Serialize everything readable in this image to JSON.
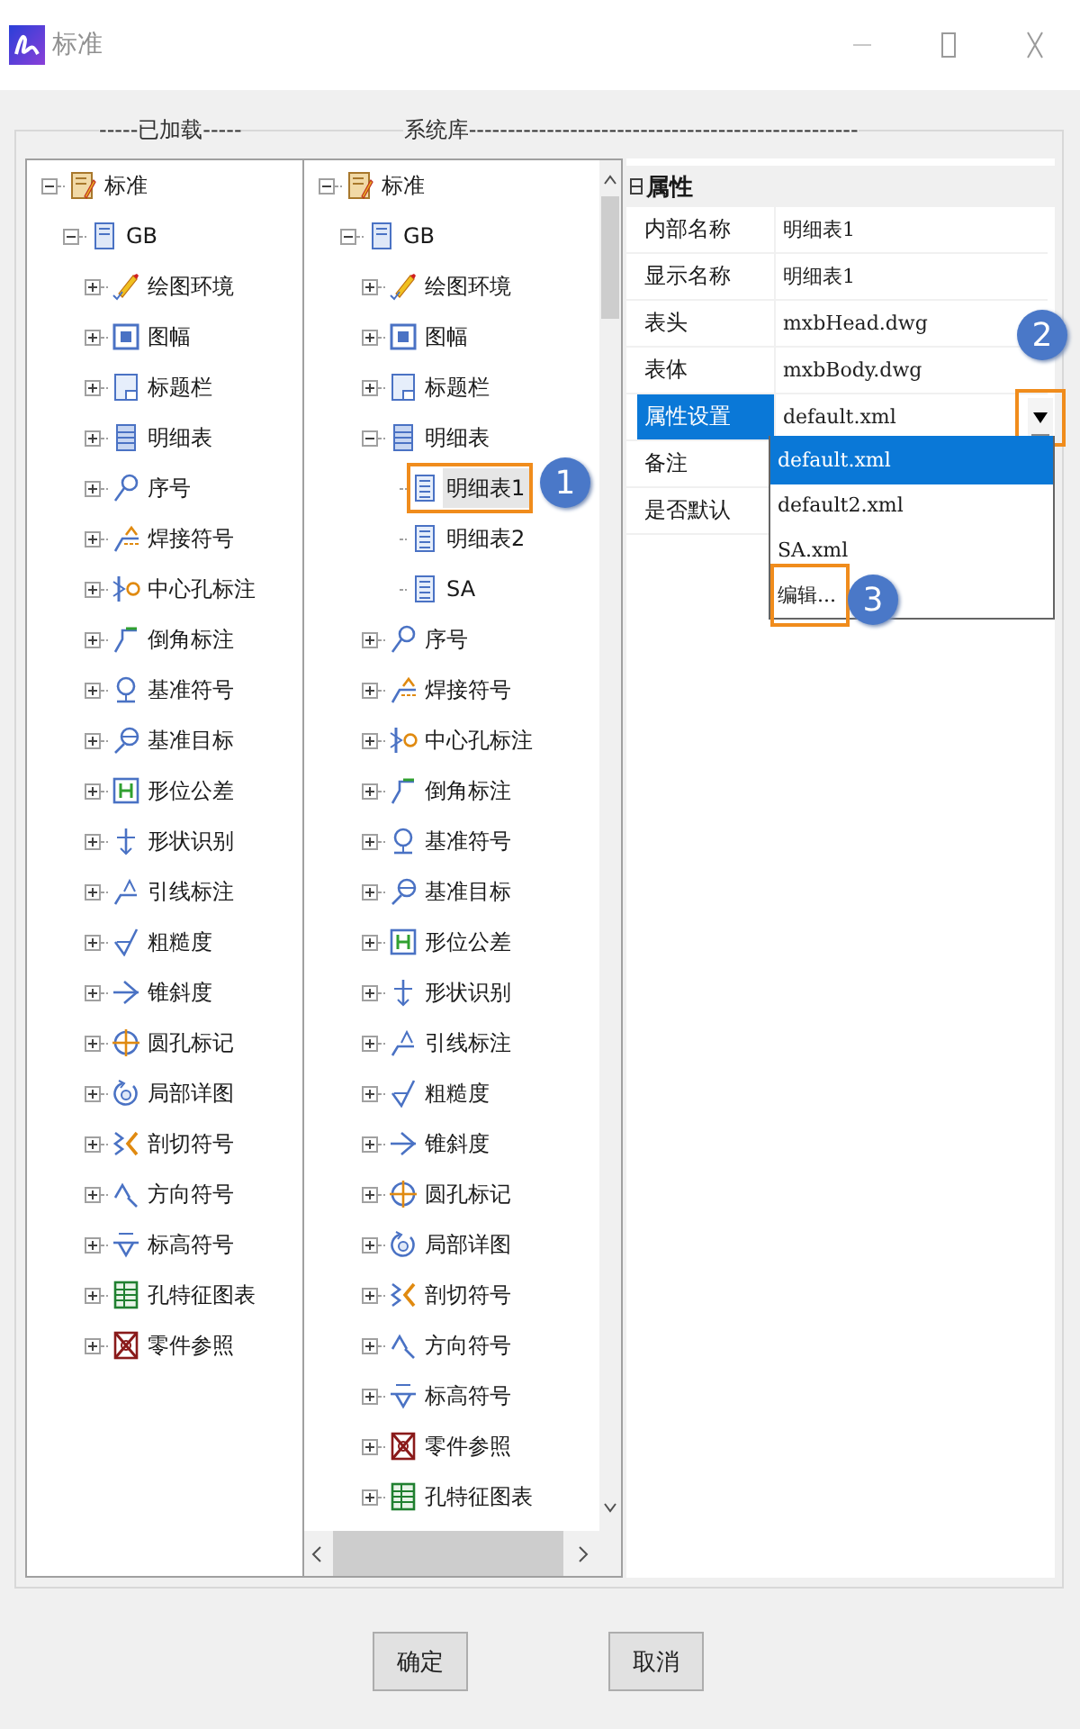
{
  "window": {
    "title": "标准"
  },
  "panels": {
    "loaded": {
      "heading": "-----已加载-----",
      "tree": [
        {
          "label": "标准",
          "kind": "book",
          "expanded": true,
          "selected": false,
          "children": [
            {
              "label": "GB",
              "kind": "doc",
              "expanded": true,
              "selected": false,
              "children": [
                {
                  "label": "绘图环境",
                  "kind": "pencil",
                  "expanded": false,
                  "selected": false
                },
                {
                  "label": "图幅",
                  "kind": "frame",
                  "expanded": false,
                  "selected": false
                },
                {
                  "label": "标题栏",
                  "kind": "titleblock",
                  "expanded": false,
                  "selected": false
                },
                {
                  "label": "明细表",
                  "kind": "table",
                  "expanded": false,
                  "selected": false
                },
                {
                  "label": "序号",
                  "kind": "balloon",
                  "expanded": false,
                  "selected": false
                },
                {
                  "label": "焊接符号",
                  "kind": "weld",
                  "expanded": false,
                  "selected": false
                },
                {
                  "label": "中心孔标注",
                  "kind": "center",
                  "expanded": false,
                  "selected": false
                },
                {
                  "label": "倒角标注",
                  "kind": "chamfer",
                  "expanded": false,
                  "selected": false
                },
                {
                  "label": "基准符号",
                  "kind": "datum",
                  "expanded": false,
                  "selected": false
                },
                {
                  "label": "基准目标",
                  "kind": "target",
                  "expanded": false,
                  "selected": false
                },
                {
                  "label": "形位公差",
                  "kind": "tolerance",
                  "expanded": false,
                  "selected": false
                },
                {
                  "label": "形状识别",
                  "kind": "shape",
                  "expanded": false,
                  "selected": false
                },
                {
                  "label": "引线标注",
                  "kind": "leader",
                  "expanded": false,
                  "selected": false
                },
                {
                  "label": "粗糙度",
                  "kind": "rough",
                  "expanded": false,
                  "selected": false
                },
                {
                  "label": "锥斜度",
                  "kind": "taper",
                  "expanded": false,
                  "selected": false
                },
                {
                  "label": "圆孔标记",
                  "kind": "hole",
                  "expanded": false,
                  "selected": false
                },
                {
                  "label": "局部详图",
                  "kind": "detail",
                  "expanded": false,
                  "selected": false
                },
                {
                  "label": "剖切符号",
                  "kind": "section",
                  "expanded": false,
                  "selected": false
                },
                {
                  "label": "方向符号",
                  "kind": "direction",
                  "expanded": false,
                  "selected": false
                },
                {
                  "label": "标高符号",
                  "kind": "elevation",
                  "expanded": false,
                  "selected": false
                },
                {
                  "label": "孔特征图表",
                  "kind": "holetable",
                  "expanded": false,
                  "selected": false
                },
                {
                  "label": "零件参照",
                  "kind": "partref",
                  "expanded": false,
                  "selected": false
                }
              ]
            }
          ]
        }
      ]
    },
    "library": {
      "heading": "系统库--------------------------------------------------",
      "tree": [
        {
          "label": "标准",
          "kind": "book",
          "expanded": true,
          "selected": false,
          "children": [
            {
              "label": "GB",
              "kind": "doc",
              "expanded": true,
              "selected": false,
              "children": [
                {
                  "label": "绘图环境",
                  "kind": "pencil",
                  "expanded": false,
                  "selected": false
                },
                {
                  "label": "图幅",
                  "kind": "frame",
                  "expanded": false,
                  "selected": false
                },
                {
                  "label": "标题栏",
                  "kind": "titleblock",
                  "expanded": false,
                  "selected": false
                },
                {
                  "label": "明细表",
                  "kind": "table",
                  "expanded": true,
                  "selected": false,
                  "children": [
                    {
                      "label": "明细表1",
                      "kind": "sheet",
                      "selected": true,
                      "annotated": true
                    },
                    {
                      "label": "明细表2",
                      "kind": "sheet",
                      "selected": false
                    },
                    {
                      "label": "SA",
                      "kind": "sheet",
                      "selected": false
                    }
                  ]
                },
                {
                  "label": "序号",
                  "kind": "balloon",
                  "expanded": false,
                  "selected": false
                },
                {
                  "label": "焊接符号",
                  "kind": "weld",
                  "expanded": false,
                  "selected": false
                },
                {
                  "label": "中心孔标注",
                  "kind": "center",
                  "expanded": false,
                  "selected": false
                },
                {
                  "label": "倒角标注",
                  "kind": "chamfer",
                  "expanded": false,
                  "selected": false
                },
                {
                  "label": "基准符号",
                  "kind": "datum",
                  "expanded": false,
                  "selected": false
                },
                {
                  "label": "基准目标",
                  "kind": "target",
                  "expanded": false,
                  "selected": false
                },
                {
                  "label": "形位公差",
                  "kind": "tolerance",
                  "expanded": false,
                  "selected": false
                },
                {
                  "label": "形状识别",
                  "kind": "shape",
                  "expanded": false,
                  "selected": false
                },
                {
                  "label": "引线标注",
                  "kind": "leader",
                  "expanded": false,
                  "selected": false
                },
                {
                  "label": "粗糙度",
                  "kind": "rough",
                  "expanded": false,
                  "selected": false
                },
                {
                  "label": "锥斜度",
                  "kind": "taper",
                  "expanded": false,
                  "selected": false
                },
                {
                  "label": "圆孔标记",
                  "kind": "hole",
                  "expanded": false,
                  "selected": false
                },
                {
                  "label": "局部详图",
                  "kind": "detail",
                  "expanded": false,
                  "selected": false
                },
                {
                  "label": "剖切符号",
                  "kind": "section",
                  "expanded": false,
                  "selected": false
                },
                {
                  "label": "方向符号",
                  "kind": "direction",
                  "expanded": false,
                  "selected": false
                },
                {
                  "label": "标高符号",
                  "kind": "elevation",
                  "expanded": false,
                  "selected": false
                },
                {
                  "label": "零件参照",
                  "kind": "partref",
                  "expanded": false,
                  "selected": false
                },
                {
                  "label": "孔特征图表",
                  "kind": "holetable",
                  "expanded": false,
                  "selected": false
                }
              ]
            }
          ]
        }
      ]
    }
  },
  "properties": {
    "heading": "属性",
    "rows": [
      {
        "label": "内部名称",
        "value": "明细表1",
        "selected": false
      },
      {
        "label": "显示名称",
        "value": "明细表1",
        "selected": false
      },
      {
        "label": "表头",
        "value": "mxbHead.dwg",
        "selected": false
      },
      {
        "label": "表体",
        "value": "mxbBody.dwg",
        "selected": false
      },
      {
        "label": "属性设置",
        "value": "default.xml",
        "selected": true
      },
      {
        "label": "备注",
        "selected": false
      },
      {
        "label": "是否默认",
        "selected": false
      }
    ],
    "dropdown": {
      "button_annotated": true,
      "options": [
        {
          "label": "default.xml",
          "selected": true,
          "annotated": false
        },
        {
          "label": "default2.xml",
          "selected": false,
          "annotated": false
        },
        {
          "label": "SA.xml",
          "selected": false,
          "annotated": false
        },
        {
          "label": "编辑...",
          "selected": false,
          "annotated": true
        }
      ]
    }
  },
  "buttons": [
    {
      "label": "确定"
    },
    {
      "label": "取消"
    }
  ],
  "callouts": [
    {
      "label": "1"
    },
    {
      "label": "2"
    },
    {
      "label": "3"
    }
  ]
}
